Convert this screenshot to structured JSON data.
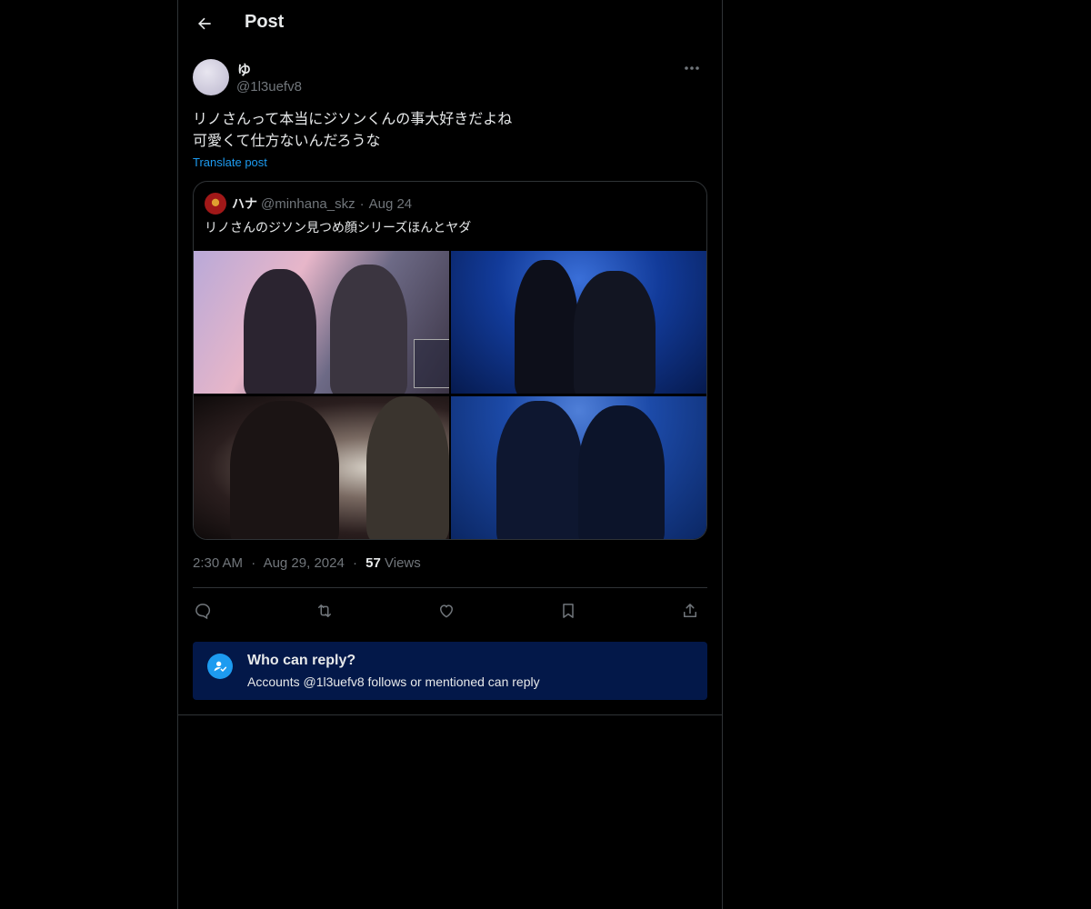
{
  "header": {
    "title": "Post",
    "back_icon": "arrow-left-icon"
  },
  "post": {
    "author": {
      "display_name": "ゆ",
      "handle": "@1l3uefv8"
    },
    "more_icon": "more-horizontal-icon",
    "text_lines": [
      "リノさんって本当にジソンくんの事大好きだよね",
      "可愛くて仕方ないんだろうな"
    ],
    "translate_label": "Translate post",
    "quote": {
      "display_name": "ハナ",
      "handle": "@minhana_skz",
      "separator": "·",
      "date": "Aug 24",
      "text": "リノさんのジソン見つめ顔シリーズほんとヤダ"
    },
    "meta": {
      "time": "2:30 AM",
      "dot1": "·",
      "date": "Aug 29, 2024",
      "dot2": "·",
      "views_count": "57",
      "views_label": "Views"
    },
    "actions": [
      {
        "name": "reply",
        "icon": "reply-icon"
      },
      {
        "name": "repost",
        "icon": "repost-icon"
      },
      {
        "name": "like",
        "icon": "heart-icon"
      },
      {
        "name": "bookmark",
        "icon": "bookmark-icon"
      },
      {
        "name": "share",
        "icon": "share-icon"
      }
    ]
  },
  "reply_settings": {
    "title": "Who can reply?",
    "description": "Accounts @1l3uefv8 follows or mentioned can reply",
    "icon": "person-check-icon"
  },
  "colors": {
    "background": "#000000",
    "text_primary": "#e7e9ea",
    "text_secondary": "#71767b",
    "accent": "#1d9bf0",
    "border": "#2f3336",
    "reply_box": "#031849"
  }
}
